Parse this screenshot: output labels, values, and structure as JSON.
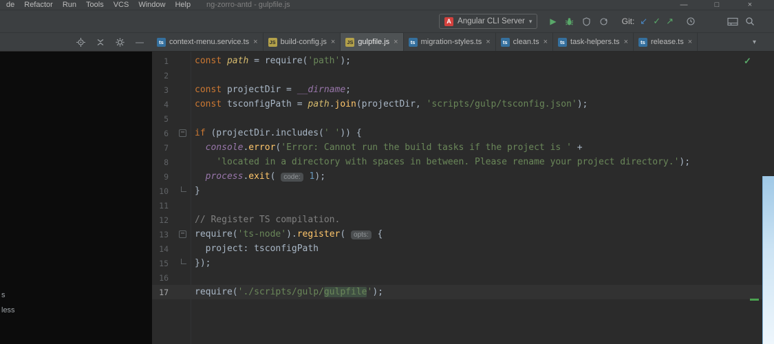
{
  "window": {
    "title": "ng-zorro-antd - gulpfile.js"
  },
  "menubar": {
    "items": [
      "de",
      "Refactor",
      "Run",
      "Tools",
      "VCS",
      "Window",
      "Help"
    ]
  },
  "icons": {
    "minimize": "—",
    "maximize": "□",
    "close": "×",
    "tab_close": "×",
    "chevron_down": "▾",
    "combo_arrow": "▾",
    "play": "▶",
    "update_arrow": "↙",
    "commit_check": "✓",
    "push_arrow": "↗",
    "check": "✓",
    "fold_minus": "−",
    "panel_minus": "—",
    "angular_letter": "A"
  },
  "toolbar": {
    "run_config": "Angular CLI Server",
    "git_label": "Git:"
  },
  "tabs": {
    "items": [
      {
        "label": "context-menu.service.ts",
        "type": "ts",
        "badge": "ts",
        "active": false
      },
      {
        "label": "build-config.js",
        "type": "js",
        "badge": "JS",
        "active": false
      },
      {
        "label": "gulpfile.js",
        "type": "js",
        "badge": "JS",
        "active": true
      },
      {
        "label": "migration-styles.ts",
        "type": "ts",
        "badge": "ts",
        "active": false
      },
      {
        "label": "clean.ts",
        "type": "ts",
        "badge": "ts",
        "active": false
      },
      {
        "label": "task-helpers.ts",
        "type": "ts",
        "badge": "ts",
        "active": false
      },
      {
        "label": "release.ts",
        "type": "ts",
        "badge": "ts",
        "active": false
      }
    ]
  },
  "project_panel": {
    "items": [
      "s",
      "less"
    ]
  },
  "editor": {
    "lines": [
      {
        "num": 1,
        "fold": null,
        "current": false,
        "tokens": [
          {
            "t": "const ",
            "c": "kw"
          },
          {
            "t": "path",
            "c": "mod"
          },
          {
            "t": " = require(",
            "c": "def"
          },
          {
            "t": "'path'",
            "c": "str"
          },
          {
            "t": ");",
            "c": "def"
          }
        ]
      },
      {
        "num": 2,
        "fold": null,
        "current": false,
        "tokens": []
      },
      {
        "num": 3,
        "fold": null,
        "current": false,
        "tokens": [
          {
            "t": "const ",
            "c": "kw"
          },
          {
            "t": "projectDir = ",
            "c": "def"
          },
          {
            "t": "__dirname",
            "c": "glob"
          },
          {
            "t": ";",
            "c": "def"
          }
        ]
      },
      {
        "num": 4,
        "fold": null,
        "current": false,
        "tokens": [
          {
            "t": "const ",
            "c": "kw"
          },
          {
            "t": "tsconfigPath = ",
            "c": "def"
          },
          {
            "t": "path",
            "c": "mod"
          },
          {
            "t": ".",
            "c": "def"
          },
          {
            "t": "join",
            "c": "fn"
          },
          {
            "t": "(projectDir, ",
            "c": "def"
          },
          {
            "t": "'scripts/gulp/tsconfig.json'",
            "c": "str"
          },
          {
            "t": ");",
            "c": "def"
          }
        ]
      },
      {
        "num": 5,
        "fold": null,
        "current": false,
        "tokens": []
      },
      {
        "num": 6,
        "fold": "start",
        "current": false,
        "tokens": [
          {
            "t": "if ",
            "c": "kw"
          },
          {
            "t": "(projectDir.includes(",
            "c": "def"
          },
          {
            "t": "' '",
            "c": "str"
          },
          {
            "t": ")) {",
            "c": "def"
          }
        ]
      },
      {
        "num": 7,
        "fold": null,
        "current": false,
        "tokens": [
          {
            "t": "  ",
            "c": "def"
          },
          {
            "t": "console",
            "c": "glob"
          },
          {
            "t": ".",
            "c": "def"
          },
          {
            "t": "error",
            "c": "fn"
          },
          {
            "t": "(",
            "c": "def"
          },
          {
            "t": "'Error: Cannot run the build tasks if the project is '",
            "c": "str"
          },
          {
            "t": " +",
            "c": "def"
          }
        ]
      },
      {
        "num": 8,
        "fold": null,
        "current": false,
        "tokens": [
          {
            "t": "    ",
            "c": "def"
          },
          {
            "t": "'located in a directory with spaces in between. Please rename your project directory.'",
            "c": "str"
          },
          {
            "t": ");",
            "c": "def"
          }
        ]
      },
      {
        "num": 9,
        "fold": null,
        "current": false,
        "tokens": [
          {
            "t": "  ",
            "c": "def"
          },
          {
            "t": "process",
            "c": "glob"
          },
          {
            "t": ".",
            "c": "def"
          },
          {
            "t": "exit",
            "c": "fn"
          },
          {
            "t": "( ",
            "c": "def"
          },
          {
            "t": "code:",
            "c": "hint"
          },
          {
            "t": " ",
            "c": "def"
          },
          {
            "t": "1",
            "c": "num"
          },
          {
            "t": ");",
            "c": "def"
          }
        ]
      },
      {
        "num": 10,
        "fold": "end",
        "current": false,
        "tokens": [
          {
            "t": "}",
            "c": "def"
          }
        ]
      },
      {
        "num": 11,
        "fold": null,
        "current": false,
        "tokens": []
      },
      {
        "num": 12,
        "fold": null,
        "current": false,
        "tokens": [
          {
            "t": "// Register TS compilation.",
            "c": "com"
          }
        ]
      },
      {
        "num": 13,
        "fold": "start",
        "current": false,
        "tokens": [
          {
            "t": "require(",
            "c": "def"
          },
          {
            "t": "'ts-node'",
            "c": "str"
          },
          {
            "t": ").",
            "c": "def"
          },
          {
            "t": "register",
            "c": "fn"
          },
          {
            "t": "( ",
            "c": "def"
          },
          {
            "t": "opts:",
            "c": "hint"
          },
          {
            "t": " {",
            "c": "def"
          }
        ]
      },
      {
        "num": 14,
        "fold": null,
        "current": false,
        "tokens": [
          {
            "t": "  project: tsconfigPath",
            "c": "def"
          }
        ]
      },
      {
        "num": 15,
        "fold": "end",
        "current": false,
        "tokens": [
          {
            "t": "});",
            "c": "def"
          }
        ]
      },
      {
        "num": 16,
        "fold": null,
        "current": false,
        "tokens": []
      },
      {
        "num": 17,
        "fold": null,
        "current": true,
        "tokens": [
          {
            "t": "require(",
            "c": "def"
          },
          {
            "t": "'./scripts/gulp/",
            "c": "str"
          },
          {
            "t": "gulpfile",
            "c": "strhl"
          },
          {
            "t": "'",
            "c": "str"
          },
          {
            "t": ");",
            "c": "def"
          }
        ]
      }
    ]
  },
  "colors": {
    "chrome_bg": "#3c3f41",
    "editor_bg": "#2b2b2b",
    "current_line_bg": "#323232",
    "keyword": "#cc7832",
    "string": "#6a8759",
    "accent_green": "#59A869",
    "accent_blue": "#4a88c7",
    "angular_red": "#d3413d"
  }
}
